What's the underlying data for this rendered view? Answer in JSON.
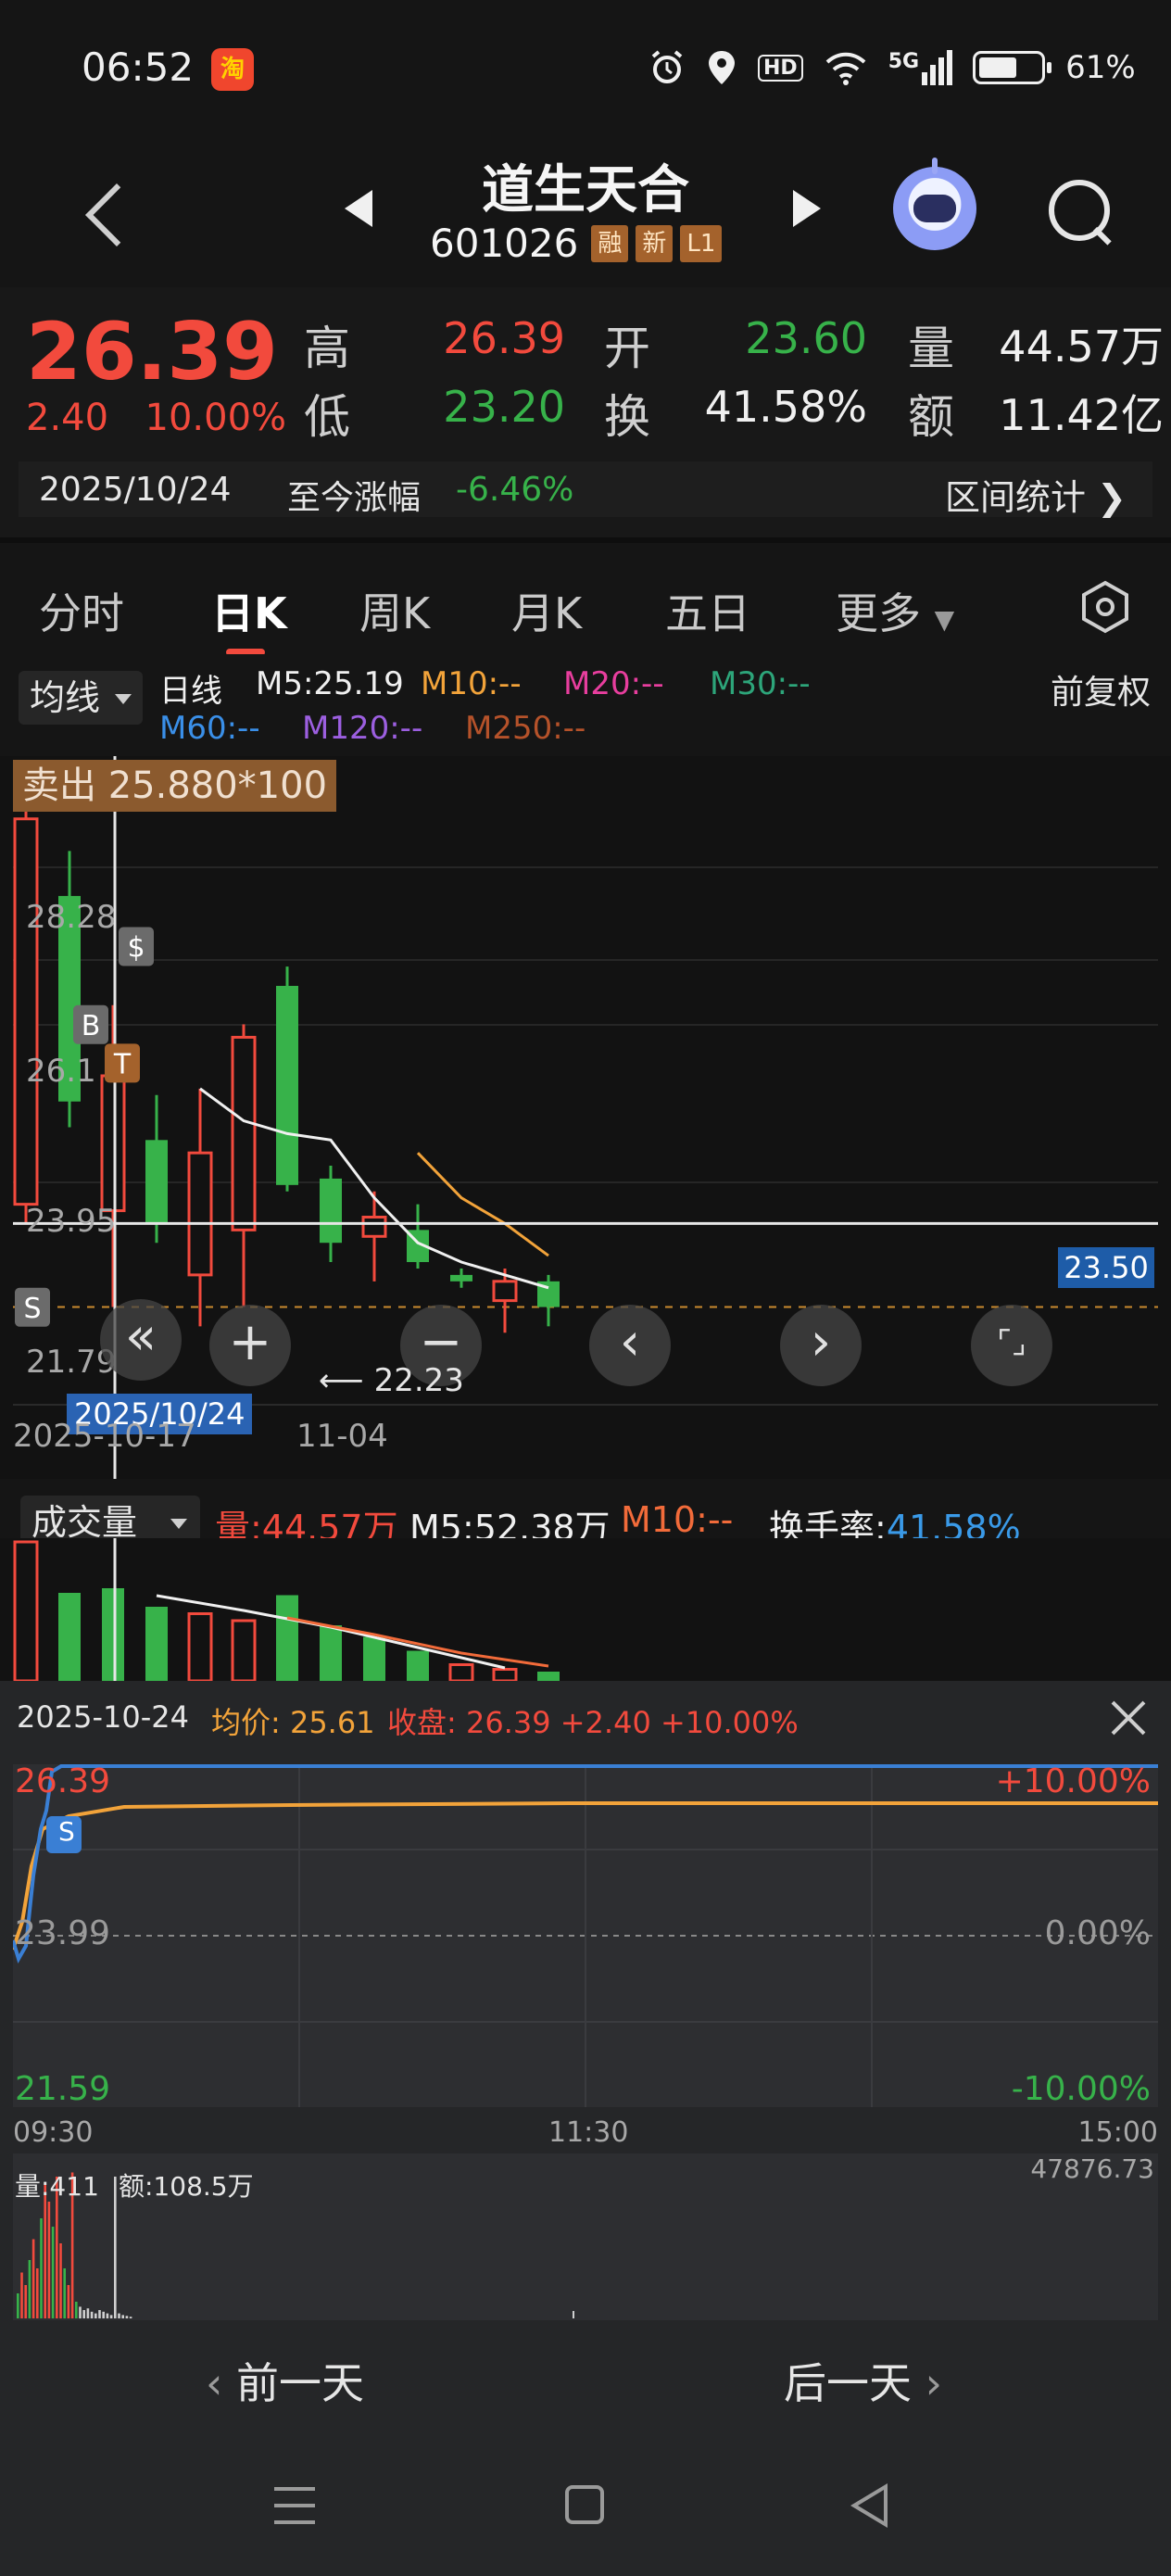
{
  "status_bar": {
    "time": "06:52",
    "app_icon_label": "淘",
    "network": "5G",
    "battery_pct": "61%",
    "hd": "HD"
  },
  "header": {
    "stock_name": "道生天合",
    "stock_code": "601026",
    "tags": [
      "融",
      "新",
      "L1"
    ]
  },
  "quote": {
    "price": "26.39",
    "change_abs": "2.40",
    "change_pct": "10.00%",
    "high_label": "高",
    "high": "26.39",
    "low_label": "低",
    "low": "23.20",
    "open_label": "开",
    "open": "23.60",
    "turnover_label": "换",
    "turnover": "41.58%",
    "volume_label": "量",
    "volume": "44.57万",
    "amount_label": "额",
    "amount": "11.42亿",
    "date": "2025/10/24",
    "since_label": "至今涨幅",
    "since_value": "-6.46%",
    "range_stats": "区间统计"
  },
  "tabs": [
    "分时",
    "日K",
    "周K",
    "月K",
    "五日",
    "更多"
  ],
  "active_tab": "日K",
  "indicators": {
    "ma_select": "均线",
    "line_type": "日线",
    "m5": "M5:25.19",
    "m10": "M10:--",
    "m20": "M20:--",
    "m30": "M30:--",
    "m60": "M60:--",
    "m120": "M120:--",
    "m250": "M250:--",
    "adjust": "前复权",
    "colors": {
      "m5": "#f0f0f0",
      "m10": "#f2a33a",
      "m20": "#e83e9e",
      "m30": "#2da57a",
      "m60": "#3a8fe8",
      "m120": "#9c5fe0",
      "m250": "#b5522a"
    }
  },
  "kline": {
    "sell_tag": "卖出 25.880*100",
    "price_line_tag": "23.50",
    "y_labels": [
      "28.28",
      "26.1",
      "23.95",
      "21.79"
    ],
    "last_close_label": "22.23",
    "cursor_date": "2025/10/24",
    "x_labels": [
      "2025-10-17",
      "11-04"
    ],
    "markers": {
      "b": "B",
      "t": "T",
      "s": "S",
      "dollar": "$"
    },
    "controls": [
      "«",
      "+",
      "−",
      "‹",
      "›",
      "⌜⌟"
    ],
    "candles": [
      {
        "o": 23.8,
        "h": 30.0,
        "l": 23.5,
        "c": 29.8,
        "dir": "up"
      },
      {
        "o": 28.6,
        "h": 29.3,
        "l": 25.0,
        "c": 25.4,
        "dir": "down"
      },
      {
        "o": 23.7,
        "h": 26.9,
        "l": 22.2,
        "c": 25.8,
        "dir": "up"
      },
      {
        "o": 24.8,
        "h": 25.5,
        "l": 23.2,
        "c": 23.5,
        "dir": "down"
      },
      {
        "o": 22.7,
        "h": 25.6,
        "l": 21.9,
        "c": 24.6,
        "dir": "up"
      },
      {
        "o": 23.4,
        "h": 26.6,
        "l": 22.2,
        "c": 26.4,
        "dir": "up"
      },
      {
        "o": 27.2,
        "h": 27.5,
        "l": 24.0,
        "c": 24.1,
        "dir": "down"
      },
      {
        "o": 24.2,
        "h": 24.4,
        "l": 22.9,
        "c": 23.2,
        "dir": "down"
      },
      {
        "o": 23.3,
        "h": 24.0,
        "l": 22.6,
        "c": 23.6,
        "dir": "up"
      },
      {
        "o": 23.4,
        "h": 23.8,
        "l": 22.8,
        "c": 22.9,
        "dir": "down"
      },
      {
        "o": 22.6,
        "h": 22.8,
        "l": 22.5,
        "c": 22.7,
        "dir": "down"
      },
      {
        "o": 22.3,
        "h": 22.8,
        "l": 21.8,
        "c": 22.6,
        "dir": "up"
      },
      {
        "o": 22.6,
        "h": 22.7,
        "l": 21.9,
        "c": 22.2,
        "dir": "down"
      }
    ],
    "ma5": [
      null,
      null,
      null,
      null,
      25.6,
      25.1,
      24.9,
      24.8,
      23.9,
      23.2,
      22.9,
      22.7,
      22.5
    ],
    "ma10": [
      null,
      null,
      null,
      null,
      null,
      null,
      null,
      null,
      null,
      24.6,
      23.9,
      23.5,
      23.0
    ]
  },
  "volume": {
    "select": "成交量",
    "vol_label": "量:44.57万",
    "m5_label": "M5:52.38万",
    "m10_label": "M10:--",
    "turnover_label": "换手率:",
    "turnover_value": "41.58%",
    "bars": [
      120,
      76,
      80,
      64,
      58,
      52,
      74,
      48,
      38,
      26,
      14,
      10,
      8
    ],
    "dirs": [
      "up",
      "down",
      "down",
      "down",
      "up",
      "up",
      "down",
      "down",
      "down",
      "down",
      "up",
      "up",
      "down"
    ]
  },
  "intraday": {
    "date": "2025-10-24",
    "avg_label": "均价: 25.61",
    "close_label": "收盘: 26.39 +2.40 +10.00%",
    "high_price": "26.39",
    "mid_price": "23.99",
    "low_price": "21.59",
    "high_pct": "+10.00%",
    "mid_pct": "0.00%",
    "low_pct": "-10.00%",
    "times": [
      "09:30",
      "11:30",
      "15:00"
    ],
    "s_marker": "S",
    "vol_label": "量:411",
    "amount_label": "额:108.5万",
    "max_vol": "47876.73"
  },
  "day_nav": {
    "prev": "前一天",
    "next": "后一天"
  }
}
